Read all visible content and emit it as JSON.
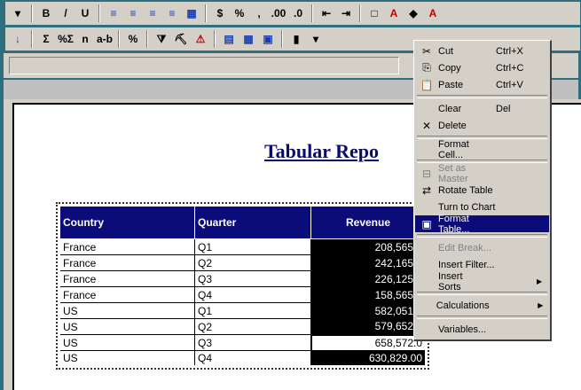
{
  "toolbar1": {
    "buttons": [
      {
        "name": "dropdown-arrow-icon",
        "glyph": "▾"
      },
      {
        "name": "bold-button",
        "glyph": "B"
      },
      {
        "name": "italic-button",
        "glyph": "/"
      },
      {
        "name": "underline-button",
        "glyph": "U"
      },
      {
        "name": "align-left-icon",
        "glyph": "≡"
      },
      {
        "name": "align-center-icon",
        "glyph": "≡"
      },
      {
        "name": "align-right-icon",
        "glyph": "≡"
      },
      {
        "name": "justify-icon",
        "glyph": "≡"
      },
      {
        "name": "merge-icon",
        "glyph": "▦"
      },
      {
        "name": "currency-button",
        "glyph": "$"
      },
      {
        "name": "percent-button",
        "glyph": "%"
      },
      {
        "name": "comma-button",
        "glyph": ","
      },
      {
        "name": "increase-decimal-button",
        "glyph": ".00"
      },
      {
        "name": "decrease-decimal-button",
        "glyph": ".0"
      },
      {
        "name": "outdent-icon",
        "glyph": "⇤"
      },
      {
        "name": "indent-icon",
        "glyph": "⇥"
      },
      {
        "name": "borders-icon",
        "glyph": "□"
      },
      {
        "name": "fill-color-icon",
        "glyph": "A"
      },
      {
        "name": "highlight-icon",
        "glyph": "◆"
      },
      {
        "name": "font-color-icon",
        "glyph": "A"
      }
    ]
  },
  "toolbar2": {
    "buttons": [
      {
        "name": "sort-icon",
        "glyph": "↓"
      },
      {
        "name": "sum-icon",
        "glyph": "Σ"
      },
      {
        "name": "percentage-sum-icon",
        "glyph": "%Σ"
      },
      {
        "name": "count-icon",
        "glyph": "n"
      },
      {
        "name": "text-case-icon",
        "glyph": "a-b"
      },
      {
        "name": "number-format-icon",
        "glyph": "%"
      },
      {
        "name": "filter-icon",
        "glyph": "⧩"
      },
      {
        "name": "drill-icon",
        "glyph": "⛏"
      },
      {
        "name": "alerter-icon",
        "glyph": "⚠"
      },
      {
        "name": "table-icon",
        "glyph": "▤"
      },
      {
        "name": "crosstab-icon",
        "glyph": "▦"
      },
      {
        "name": "format-table-icon",
        "glyph": "▣"
      },
      {
        "name": "chart-icon",
        "glyph": "▮"
      },
      {
        "name": "chart-dropdown-icon",
        "glyph": "▾"
      }
    ]
  },
  "report": {
    "title": "Tabular Repo",
    "columns": [
      "Country",
      "Quarter",
      "Revenue"
    ],
    "rows": [
      {
        "country": "France",
        "quarter": "Q1",
        "revenue": "208,565.0"
      },
      {
        "country": "France",
        "quarter": "Q2",
        "revenue": "242,165.0"
      },
      {
        "country": "France",
        "quarter": "Q3",
        "revenue": "226,125.0"
      },
      {
        "country": "France",
        "quarter": "Q4",
        "revenue": "158,565.0"
      },
      {
        "country": "US",
        "quarter": "Q1",
        "revenue": "582,051.0"
      },
      {
        "country": "US",
        "quarter": "Q2",
        "revenue": "579,652.0"
      },
      {
        "country": "US",
        "quarter": "Q3",
        "revenue": "658,572.0"
      },
      {
        "country": "US",
        "quarter": "Q4",
        "revenue": "630,829.00"
      }
    ],
    "header_color": "#0b0b7a"
  },
  "context_menu": {
    "items": [
      {
        "type": "item",
        "name": "menu-cut",
        "icon": "✂",
        "label": "Cut",
        "shortcut": "Ctrl+X",
        "disabled": false
      },
      {
        "type": "item",
        "name": "menu-copy",
        "icon": "⎘",
        "label": "Copy",
        "shortcut": "Ctrl+C",
        "disabled": false
      },
      {
        "type": "item",
        "name": "menu-paste",
        "icon": "📋",
        "label": "Paste",
        "shortcut": "Ctrl+V",
        "disabled": false
      },
      {
        "type": "sep"
      },
      {
        "type": "item",
        "name": "menu-clear",
        "icon": "",
        "label": "Clear",
        "shortcut": "Del",
        "disabled": false
      },
      {
        "type": "item",
        "name": "menu-delete",
        "icon": "✕",
        "label": "Delete",
        "shortcut": "",
        "disabled": false
      },
      {
        "type": "sep"
      },
      {
        "type": "item",
        "name": "menu-format-cell",
        "icon": "",
        "label": "Format Cell...",
        "shortcut": "",
        "disabled": false
      },
      {
        "type": "sep"
      },
      {
        "type": "item",
        "name": "menu-set-as-master",
        "icon": "⊟",
        "label": "Set as Master",
        "shortcut": "",
        "disabled": true
      },
      {
        "type": "item",
        "name": "menu-rotate-table",
        "icon": "⇄",
        "label": "Rotate Table",
        "shortcut": "",
        "disabled": false
      },
      {
        "type": "item",
        "name": "menu-turn-to-chart",
        "icon": "",
        "label": "Turn to Chart",
        "shortcut": "",
        "disabled": false
      },
      {
        "type": "item",
        "name": "menu-format-table",
        "icon": "▣",
        "label": "Format Table...",
        "shortcut": "",
        "disabled": false,
        "highlight": true
      },
      {
        "type": "sep"
      },
      {
        "type": "item",
        "name": "menu-edit-break",
        "icon": "",
        "label": "Edit Break...",
        "shortcut": "",
        "disabled": true
      },
      {
        "type": "item",
        "name": "menu-insert-filter",
        "icon": "",
        "label": "Insert Filter...",
        "shortcut": "",
        "disabled": false
      },
      {
        "type": "item",
        "name": "menu-insert-sorts",
        "icon": "",
        "label": "Insert Sorts",
        "shortcut": "",
        "disabled": false,
        "submenu": true
      },
      {
        "type": "sep"
      },
      {
        "type": "item",
        "name": "menu-calculations",
        "icon": "",
        "label": "Calculations",
        "shortcut": "",
        "disabled": false,
        "submenu": true
      },
      {
        "type": "sep"
      },
      {
        "type": "item",
        "name": "menu-variables",
        "icon": "",
        "label": "Variables...",
        "shortcut": "",
        "disabled": false
      }
    ],
    "highlight_color": "#0b0b7a"
  }
}
